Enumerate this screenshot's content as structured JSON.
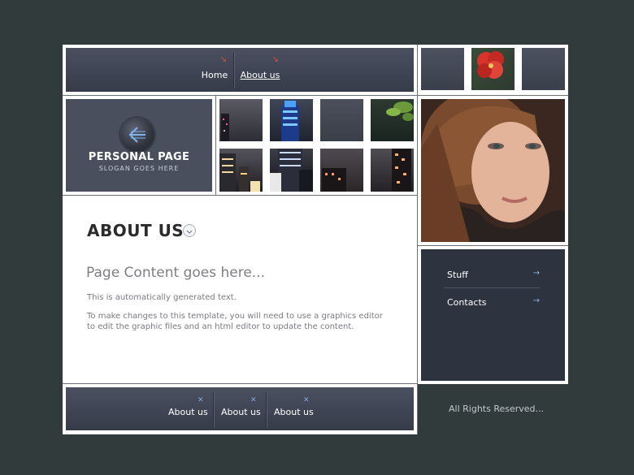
{
  "nav": {
    "items": [
      {
        "label": "Home"
      },
      {
        "label": "About us"
      }
    ]
  },
  "brand": {
    "title": "PERSONAL PAGE",
    "slogan": "SLOGAN GOES HERE"
  },
  "main": {
    "heading": "ABOUT US",
    "subheading": "Page Content goes here...",
    "paragraphs": [
      "This is automatically generated text.",
      "To make changes to this template, you will need to use a graphics editor to edit the graphic files and an html editor to update the content."
    ]
  },
  "sidebar": {
    "items": [
      {
        "label": "Stuff"
      },
      {
        "label": "Contacts"
      }
    ]
  },
  "footer": {
    "items": [
      {
        "label": "About us"
      },
      {
        "label": "About us"
      },
      {
        "label": "About us"
      }
    ],
    "rights": "All Rights Reserved..."
  },
  "colors": {
    "background": "#313b3c",
    "nav_arrow": "#d9533b",
    "side_panel": "#2e3340",
    "link_accent": "#8fb6e6"
  }
}
